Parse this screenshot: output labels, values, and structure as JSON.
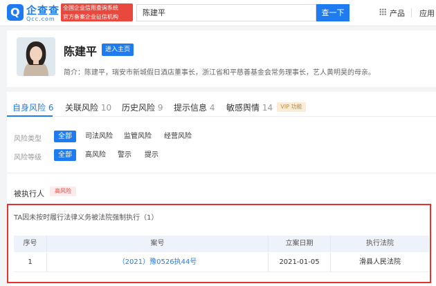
{
  "header": {
    "logo_name": "企查查",
    "logo_domain": "Qcc.com",
    "badge_line1": "全国企业信用查询系统",
    "badge_line2": "官方备案企业征信机构",
    "search_value": "陈建平",
    "search_button": "查一下",
    "nav_product": "产品",
    "nav_app": "应用"
  },
  "profile": {
    "name": "陈建平",
    "home_button": "进入主页",
    "bio": "简介：陈建平，瑞安市新城假日酒店董事长，浙江省和平慈善基金会常务理事长，艺人黄明昊的母亲。"
  },
  "tabs": [
    {
      "label": "自身风险",
      "count": "6"
    },
    {
      "label": "关联风险",
      "count": "10"
    },
    {
      "label": "历史风险",
      "count": "9"
    },
    {
      "label": "提示信息",
      "count": "4"
    },
    {
      "label": "敏感舆情",
      "count": "14"
    }
  ],
  "vip_tag": "VIP 功能",
  "filters": {
    "type_label": "风险类型",
    "type_options": [
      "全部",
      "司法风险",
      "监管风险",
      "经营风险"
    ],
    "level_label": "风险等级",
    "level_options": [
      "全部",
      "高风险",
      "警示",
      "提示"
    ]
  },
  "section": {
    "title": "被执行人",
    "risk_tag": "高风险",
    "case_title": "TA因未按时履行法律义务被法院强制执行（1）"
  },
  "table": {
    "columns": [
      "序号",
      "案号",
      "立案日期",
      "执行法院"
    ],
    "rows": [
      {
        "index": "1",
        "case_no": "（2021）豫0526执44号",
        "date": "2021-01-05",
        "court": "滑县人民法院"
      }
    ]
  }
}
